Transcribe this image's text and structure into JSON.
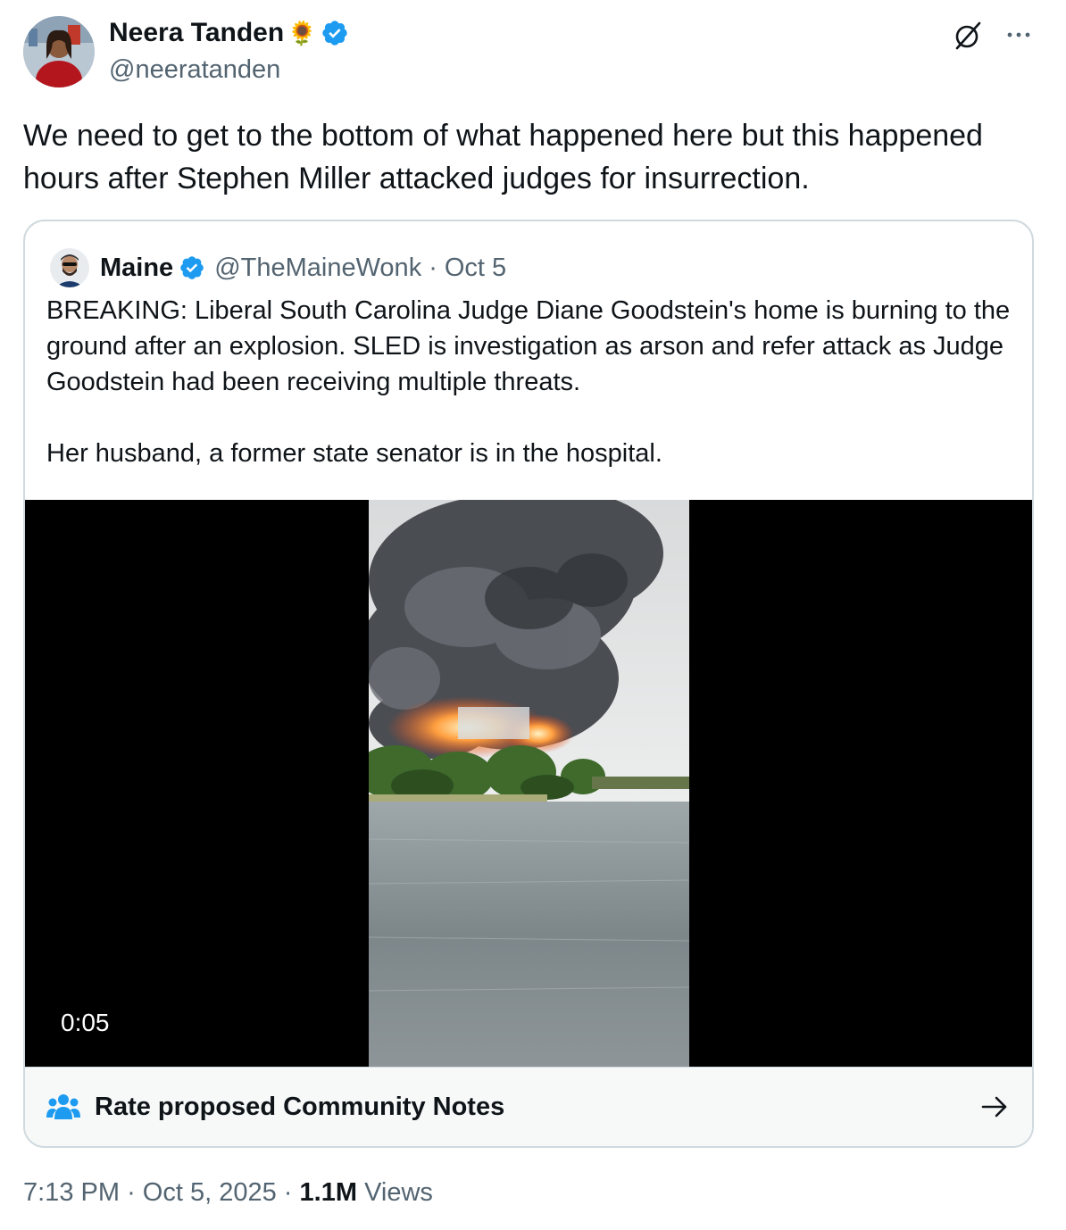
{
  "author": {
    "name": "Neera Tanden",
    "name_emoji": "🌻",
    "handle": "@neeratanden",
    "verified": true
  },
  "icons": {
    "grok": "grok-icon",
    "more": "more-icon",
    "verified": "verified-badge-icon",
    "community": "community-notes-icon",
    "arrow": "arrow-right-icon"
  },
  "colors": {
    "accent": "#1d9bf0",
    "secondary_text": "#536471",
    "border": "#cfd9de"
  },
  "tweet": {
    "text": "We need to get to the bottom of what happened here but this happened hours after Stephen Miller attacked judges for insurrection."
  },
  "quoted": {
    "name": "Maine",
    "handle": "@TheMaineWonk",
    "separator": "·",
    "date": "Oct 5",
    "paragraph1": "BREAKING:  Liberal South Carolina Judge Diane Goodstein's home is burning to the ground after an explosion. SLED is investigation as arson and refer attack as Judge Goodstein had been receiving multiple threats.",
    "paragraph2": "Her husband, a former state senator is in the hospital.",
    "video_time": "0:05"
  },
  "community_notes": {
    "label": "Rate proposed Community Notes"
  },
  "meta": {
    "time": "7:13 PM",
    "sep1": "·",
    "date": "Oct 5, 2025",
    "sep2": "·",
    "views_count": "1.1M",
    "views_label": "Views"
  }
}
